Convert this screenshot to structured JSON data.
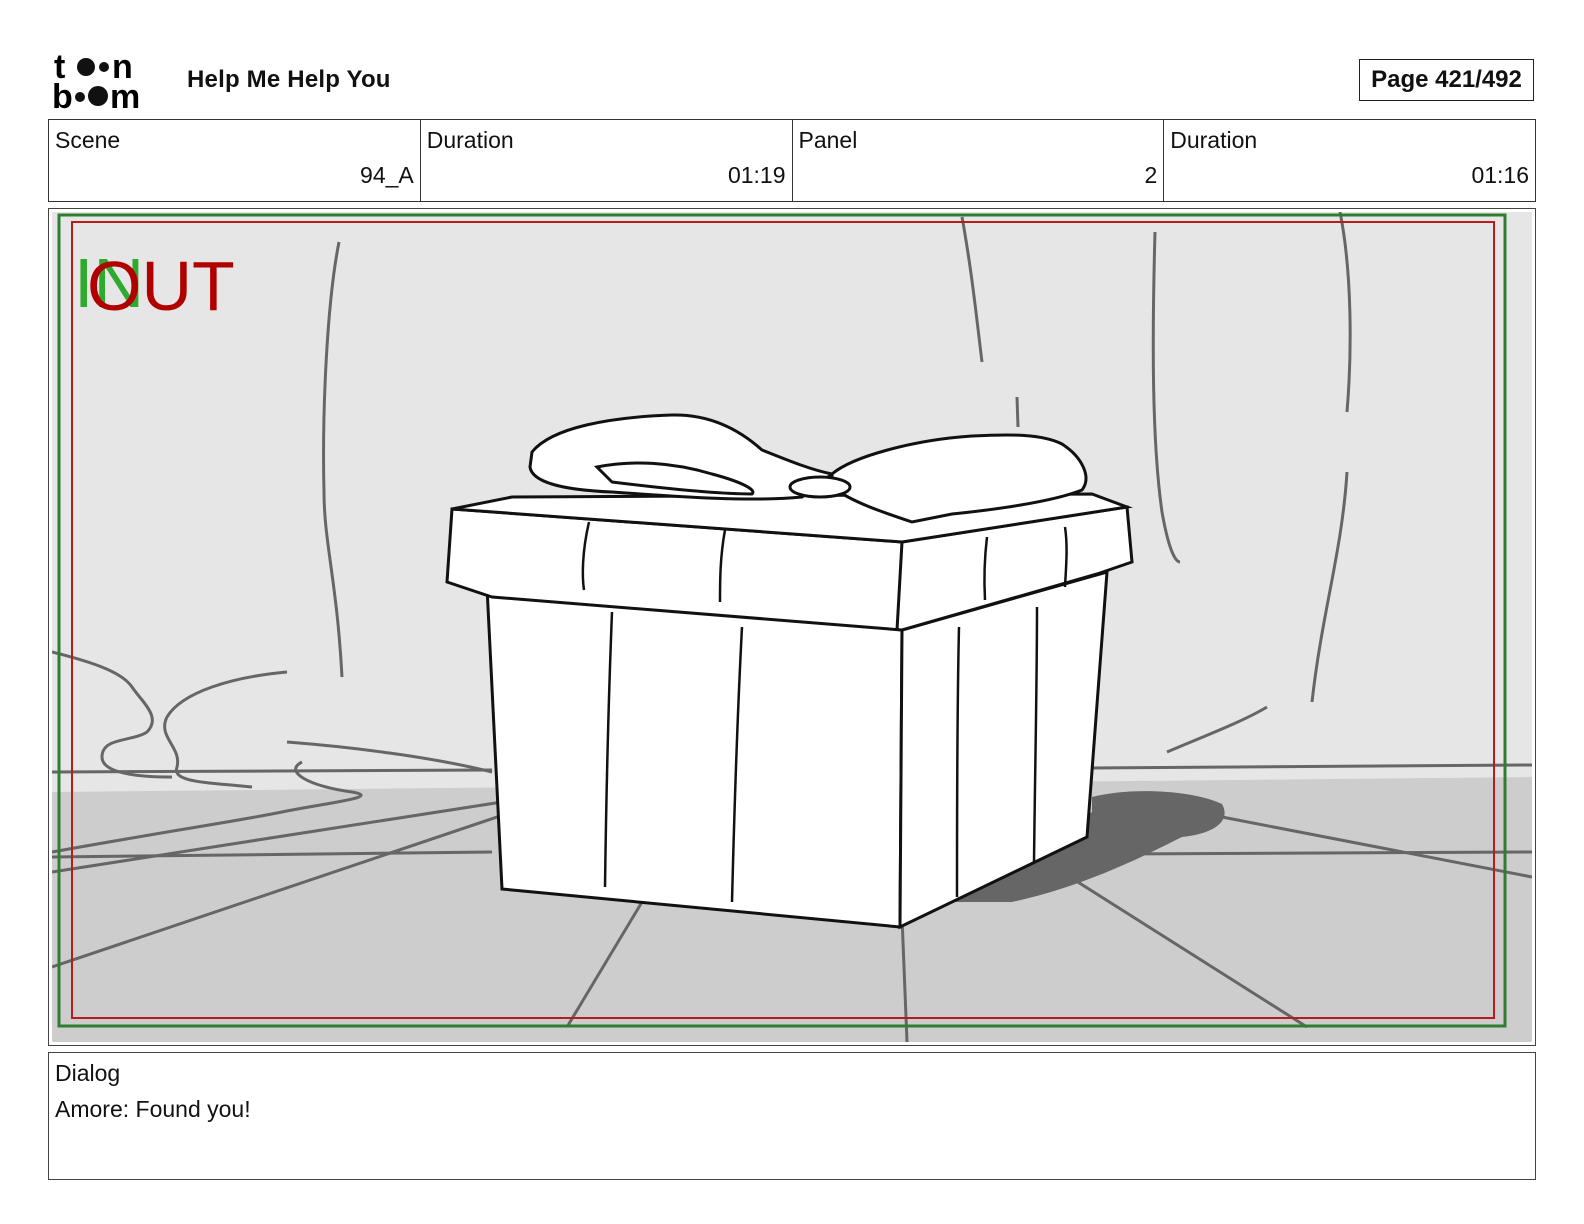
{
  "header": {
    "logo_text": "toon boom",
    "project_title": "Help Me Help You",
    "page_label": "Page 421/492"
  },
  "info": {
    "scene_label": "Scene",
    "scene_value": "94_A",
    "scene_duration_label": "Duration",
    "scene_duration_value": "01:19",
    "panel_label": "Panel",
    "panel_value": "2",
    "panel_duration_label": "Duration",
    "panel_duration_value": "01:16"
  },
  "panel": {
    "overlay_in": "IN",
    "overlay_out": "OUT",
    "colors": {
      "safe_frame_green": "#2e7d32",
      "action_frame_red": "#b71c1c",
      "shadow": "#666666"
    }
  },
  "dialog": {
    "label": "Dialog",
    "text": "Amore: Found you!"
  }
}
